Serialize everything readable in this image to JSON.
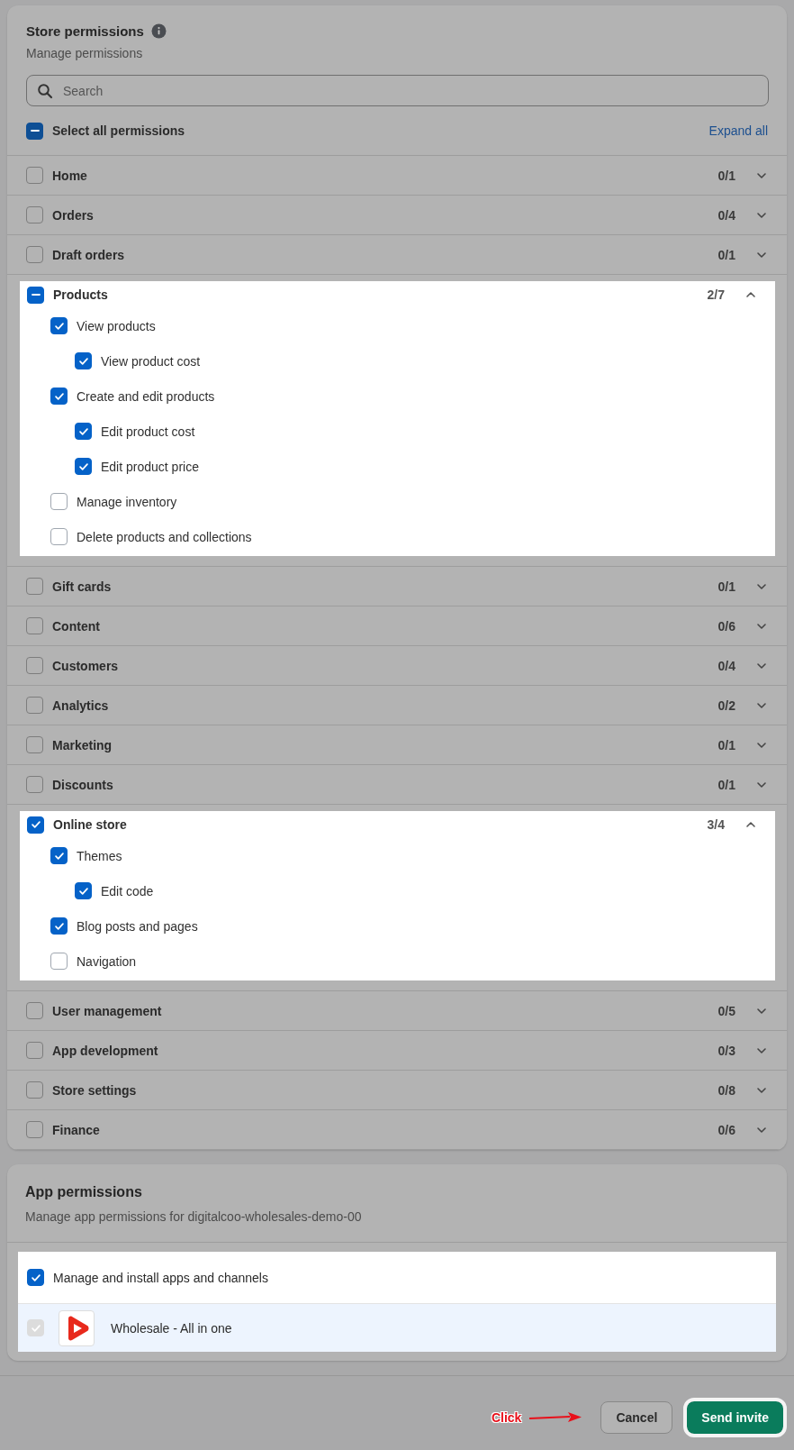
{
  "store": {
    "title": "Store permissions",
    "subtitle": "Manage permissions",
    "search": {
      "placeholder": "Search"
    },
    "select_all": {
      "label": "Select all permissions",
      "indeterminate": true
    },
    "expand_all": "Expand all",
    "groups": [
      {
        "label": "Home",
        "count": "0/1",
        "checked": false,
        "indeterminate": false,
        "expanded": false
      },
      {
        "label": "Orders",
        "count": "0/4",
        "checked": false,
        "indeterminate": false,
        "expanded": false
      },
      {
        "label": "Draft orders",
        "count": "0/1",
        "checked": false,
        "indeterminate": false,
        "expanded": false
      },
      {
        "label": "Products",
        "count": "2/7",
        "indeterminate": true,
        "expanded": true,
        "children": [
          {
            "label": "View products",
            "checked": true,
            "children": [
              {
                "label": "View product cost",
                "checked": true
              }
            ]
          },
          {
            "label": "Create and edit products",
            "checked": true,
            "children": [
              {
                "label": "Edit product cost",
                "checked": true
              },
              {
                "label": "Edit product price",
                "checked": true
              }
            ]
          },
          {
            "label": "Manage inventory",
            "checked": false
          },
          {
            "label": "Delete products and collections",
            "checked": false
          }
        ]
      },
      {
        "label": "Gift cards",
        "count": "0/1",
        "checked": false,
        "indeterminate": false,
        "expanded": false
      },
      {
        "label": "Content",
        "count": "0/6",
        "checked": false,
        "indeterminate": false,
        "expanded": false
      },
      {
        "label": "Customers",
        "count": "0/4",
        "checked": false,
        "indeterminate": false,
        "expanded": false
      },
      {
        "label": "Analytics",
        "count": "0/2",
        "checked": false,
        "indeterminate": false,
        "expanded": false
      },
      {
        "label": "Marketing",
        "count": "0/1",
        "checked": false,
        "indeterminate": false,
        "expanded": false
      },
      {
        "label": "Discounts",
        "count": "0/1",
        "checked": false,
        "indeterminate": false,
        "expanded": false
      },
      {
        "label": "Online store",
        "count": "3/4",
        "checked": true,
        "indeterminate": false,
        "expanded": true,
        "children": [
          {
            "label": "Themes",
            "checked": true,
            "children": [
              {
                "label": "Edit code",
                "checked": true
              }
            ]
          },
          {
            "label": "Blog posts and pages",
            "checked": true
          },
          {
            "label": "Navigation",
            "checked": false
          }
        ]
      },
      {
        "label": "User management",
        "count": "0/5",
        "checked": false,
        "indeterminate": false,
        "expanded": false
      },
      {
        "label": "App development",
        "count": "0/3",
        "checked": false,
        "indeterminate": false,
        "expanded": false
      },
      {
        "label": "Store settings",
        "count": "0/8",
        "checked": false,
        "indeterminate": false,
        "expanded": false
      },
      {
        "label": "Finance",
        "count": "0/6",
        "checked": false,
        "indeterminate": false,
        "expanded": false
      }
    ]
  },
  "apps": {
    "title": "App permissions",
    "subtitle": "Manage app permissions for digitalcoo-wholesales-demo-00",
    "manage": {
      "label": "Manage and install apps and channels",
      "checked": true
    },
    "items": [
      {
        "name": "Wholesale - All in one",
        "checked": true,
        "disabled": true
      }
    ]
  },
  "footer": {
    "annotation": "Click",
    "buttons": [
      {
        "label": "Cancel",
        "kind": "secondary"
      },
      {
        "label": "Send invite",
        "kind": "primary"
      }
    ]
  }
}
